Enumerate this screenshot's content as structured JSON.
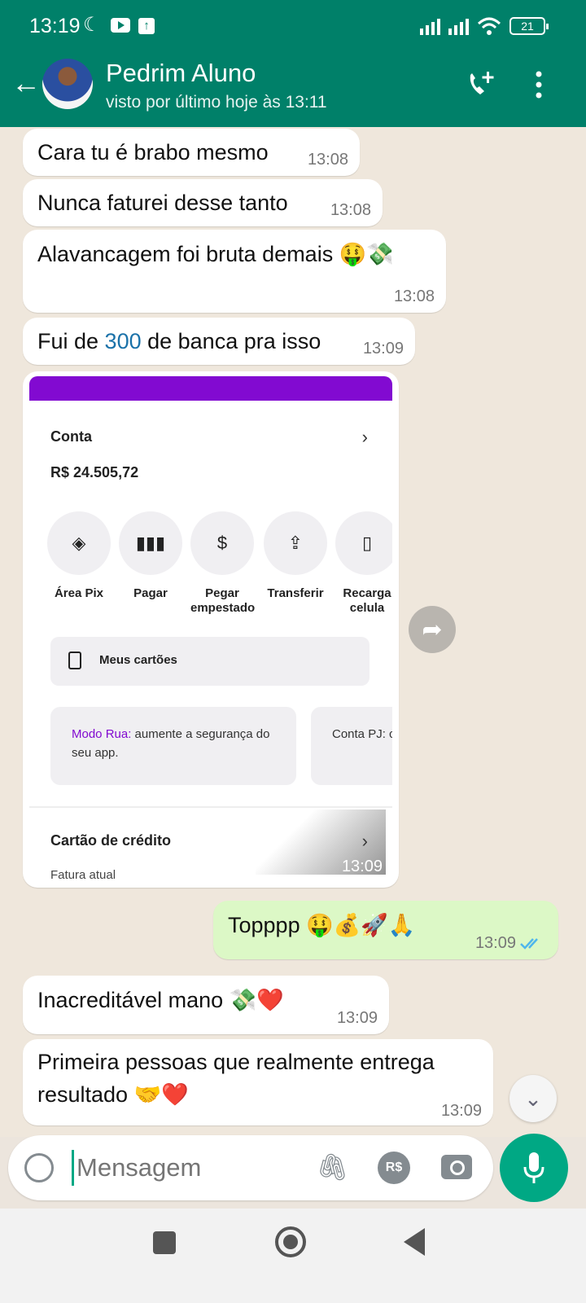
{
  "status_bar": {
    "time": "13:19",
    "battery": "21"
  },
  "header": {
    "contact_name": "Pedrim Aluno",
    "last_seen": "visto por último hoje às 13:11"
  },
  "messages": [
    {
      "text": "Cara tu é brabo mesmo",
      "time": "13:08"
    },
    {
      "text": "Nunca faturei desse tanto",
      "time": "13:08"
    },
    {
      "text": "Alavancagem foi bruta demais 🤑💸",
      "time": "13:08"
    },
    {
      "text_before": "Fui de ",
      "highlight": "300",
      "text_after": " de banca pra isso",
      "time": "13:09"
    },
    {
      "text": "Topppp 🤑💰🚀🙏",
      "time": "13:09"
    },
    {
      "text": "Inacreditável mano 💸❤️",
      "time": "13:09"
    },
    {
      "text": "Primeira pessoas que realmente entrega resultado 🤝❤️",
      "time": "13:09"
    }
  ],
  "image_message": {
    "time": "13:09",
    "conta_label": "Conta",
    "balance": "R$ 24.505,72",
    "actions": [
      {
        "label": "Área Pix",
        "icon": "pix-icon"
      },
      {
        "label": "Pagar",
        "icon": "barcode-icon"
      },
      {
        "label": "Pegar empestado",
        "icon": "loan-icon"
      },
      {
        "label": "Transferir",
        "icon": "transfer-icon"
      },
      {
        "label": "Recarga celula",
        "icon": "phone-icon"
      }
    ],
    "cards_label": "Meus cartões",
    "promo1_highlight": "Modo Rua:",
    "promo1_text": " aumente a segurança do seu app.",
    "promo2_text": "Conta PJ: c seu negóc",
    "credit_label": "Cartão de crédito",
    "invoice_label": "Fatura atual"
  },
  "input": {
    "placeholder": "Mensagem",
    "currency_badge": "R$"
  }
}
